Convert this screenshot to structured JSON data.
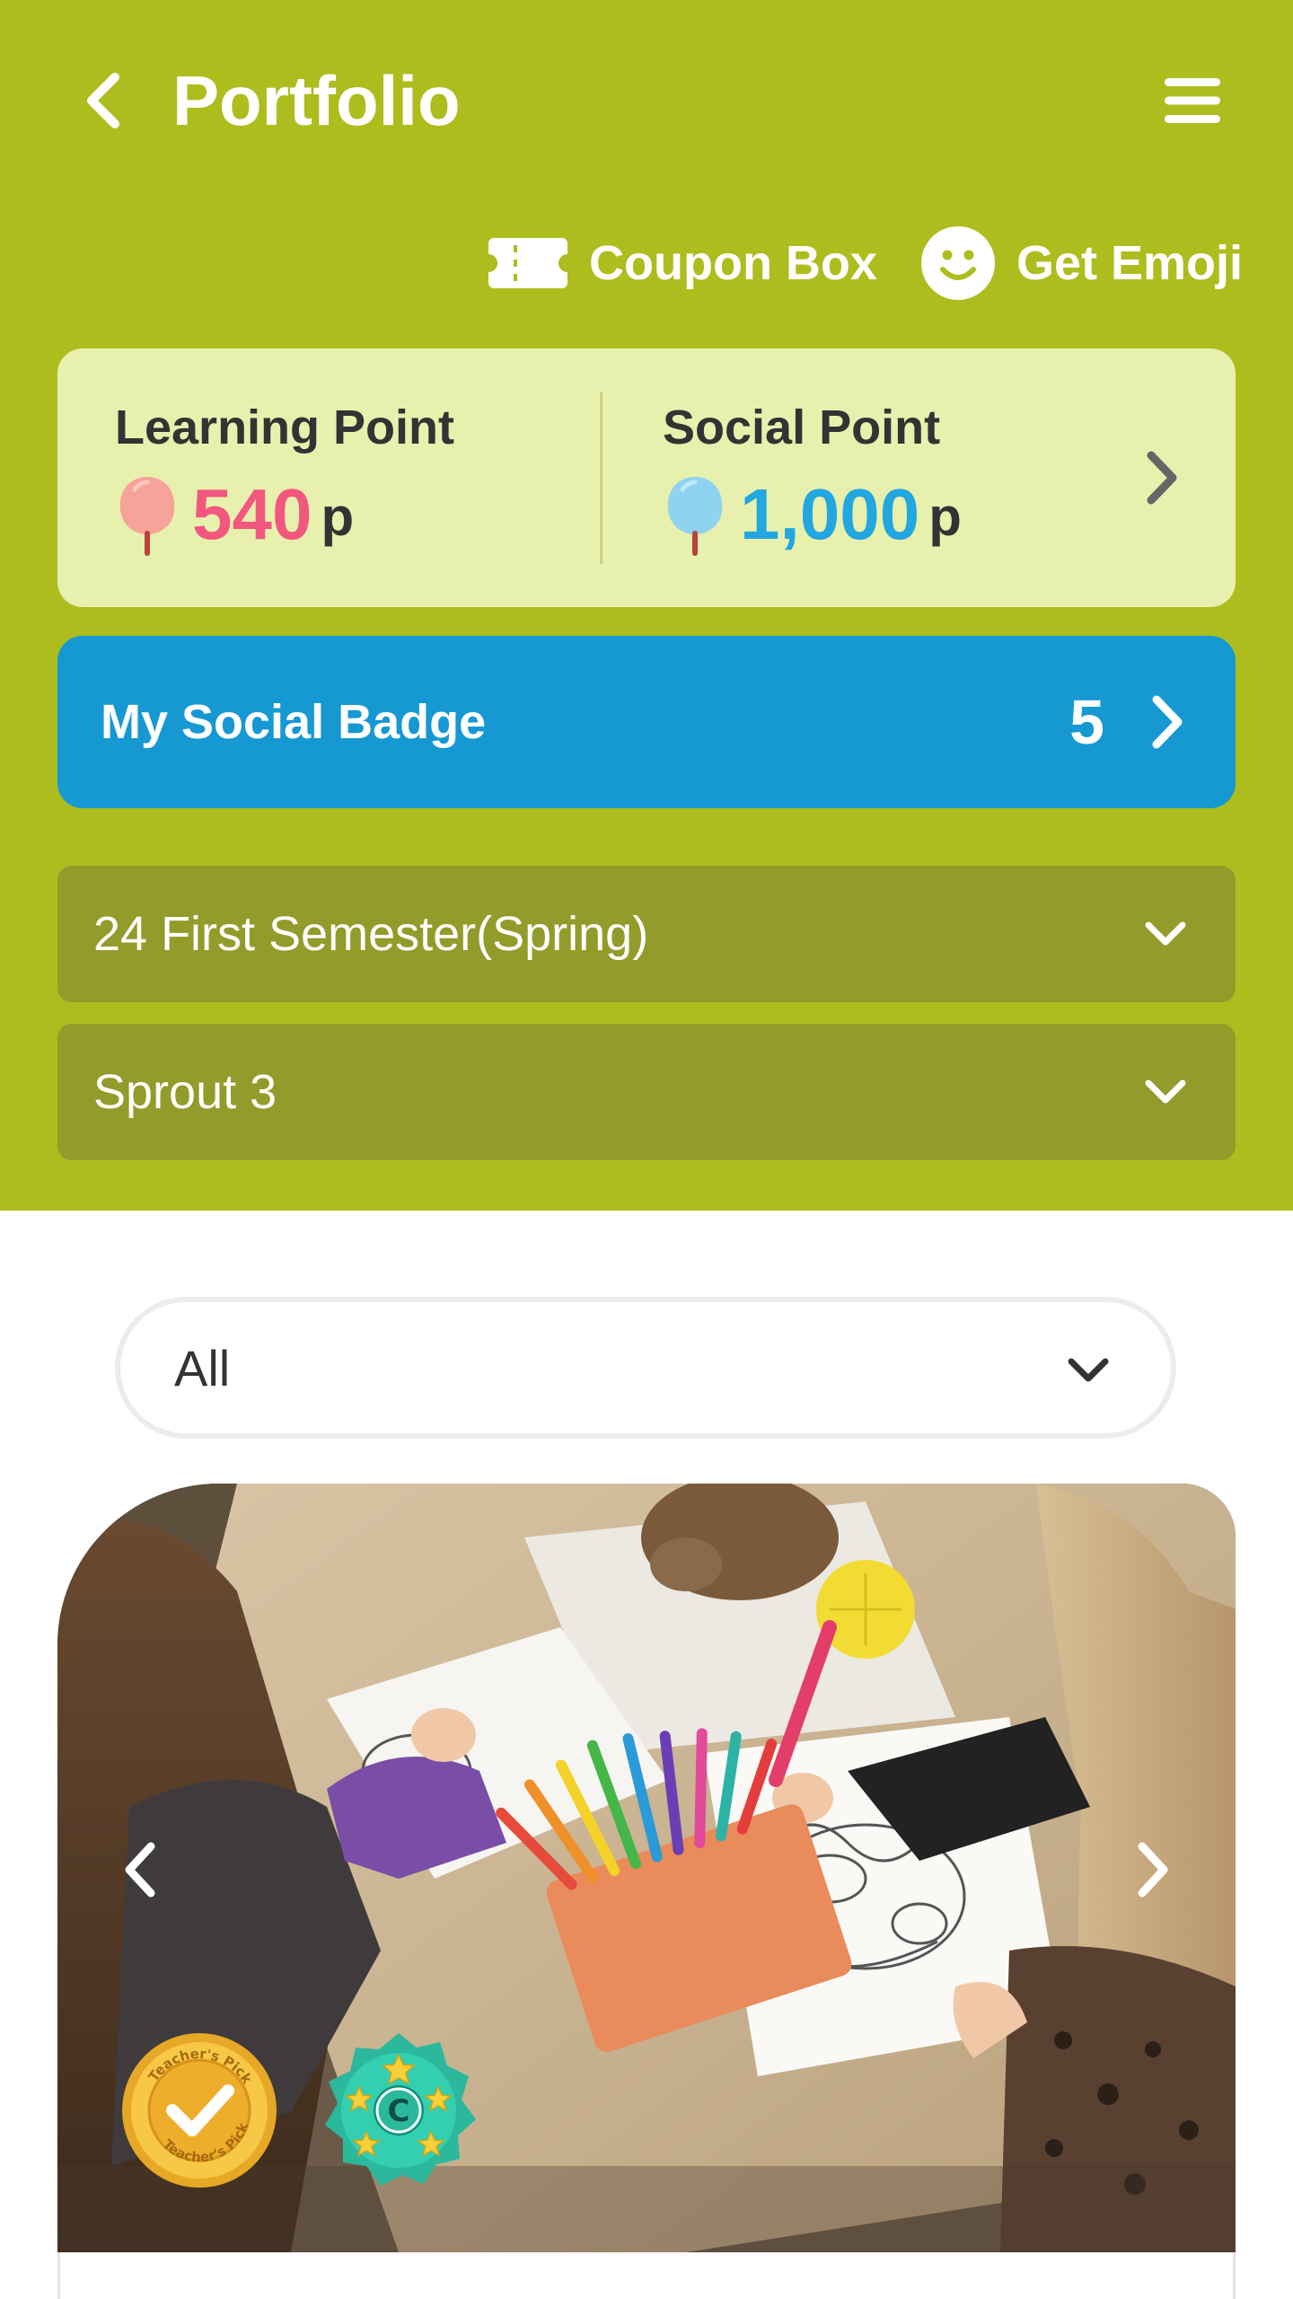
{
  "header": {
    "title": "Portfolio",
    "back_icon": "chevron-left-icon",
    "menu_icon": "hamburger-menu-icon",
    "background_color": "#adbd1e"
  },
  "actions": {
    "coupon_label": "Coupon Box",
    "coupon_icon": "ticket-icon",
    "emoji_label": "Get Emoji",
    "emoji_icon": "smiley-icon"
  },
  "points": {
    "learning_label": "Learning Point",
    "learning_value": "540",
    "learning_unit": "p",
    "learning_color": "#f2577f",
    "social_label": "Social Point",
    "social_value": "1,000",
    "social_unit": "p",
    "social_color": "#22a7e0"
  },
  "badge": {
    "label": "My Social Badge",
    "count": "5",
    "color": "#1698d3"
  },
  "dropdowns": {
    "semester": "24 First Semester(Spring)",
    "class": "Sprout 3"
  },
  "filter": {
    "selected": "All"
  },
  "photo": {
    "badges": [
      "teachers-pick-badge",
      "c-grade-star-badge"
    ],
    "badge_text": "Teacher's Pick",
    "badge_letter": "C"
  }
}
